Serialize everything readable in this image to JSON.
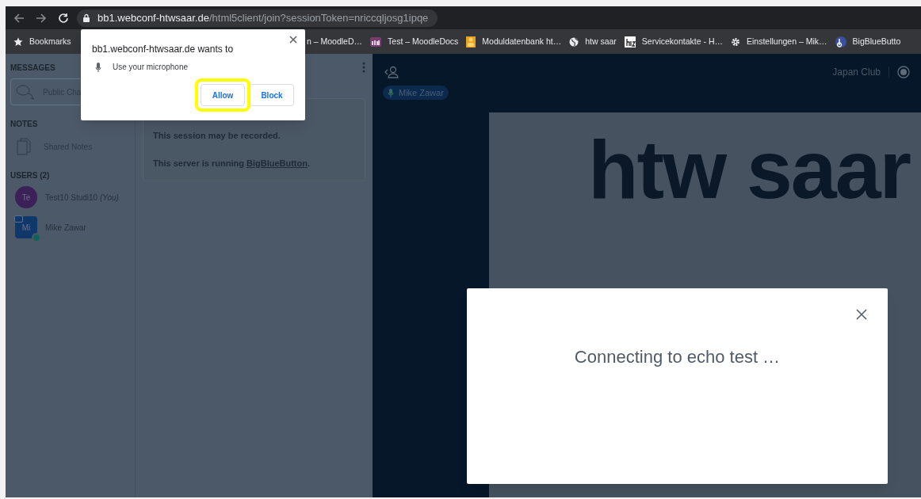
{
  "address_bar": {
    "host": "bb1.webconf-htwsaar.de",
    "path": "/html5client/join?sessionToken=nriccqljosg1ipqe"
  },
  "bookmarks": [
    {
      "label": "Bookmarks",
      "kind": "star"
    },
    {
      "label": "n – MoodleD…",
      "kind": "none"
    },
    {
      "label": "Test – MoodleDocs",
      "kind": "moodle"
    },
    {
      "label": "Moduldatenbank ht…",
      "kind": "person"
    },
    {
      "label": "htw saar",
      "kind": "globe"
    },
    {
      "label": "Servicekontakte - H…",
      "kind": "hiz"
    },
    {
      "label": "Einstellungen – Mik…",
      "kind": "gear"
    },
    {
      "label": "BigBlueButto",
      "kind": "bbb"
    }
  ],
  "permission_popup": {
    "title": "bb1.webconf-htwsaar.de wants to",
    "permission": "Use your microphone",
    "buttons": [
      {
        "label": "Allow",
        "highlighted": true
      },
      {
        "label": "Block",
        "highlighted": false
      }
    ]
  },
  "sidebar": {
    "messages_heading": "MESSAGES",
    "public_chat": "Public Cha",
    "notes_heading": "NOTES",
    "shared_notes": "Shared Notes",
    "users_heading": "USERS (2)",
    "users": [
      {
        "initials": "Te",
        "name": "Test10 Studi10 *(You)*",
        "kind": "viewer",
        "presenter": false
      },
      {
        "initials": "Mi",
        "name": "Mike Zawar",
        "kind": "moderator",
        "presenter": true
      }
    ]
  },
  "chat": {
    "welcome": [
      "This session may be recorded."
    ],
    "server_line": {
      "before": "This server is running ",
      "link": "BigBlueButton",
      "after": "."
    }
  },
  "presentation": {
    "meeting_name": "Japan Club",
    "talker": "Mike Zawar",
    "slide_text": "htw saar"
  },
  "modal": {
    "message": "Connecting to echo test …"
  }
}
